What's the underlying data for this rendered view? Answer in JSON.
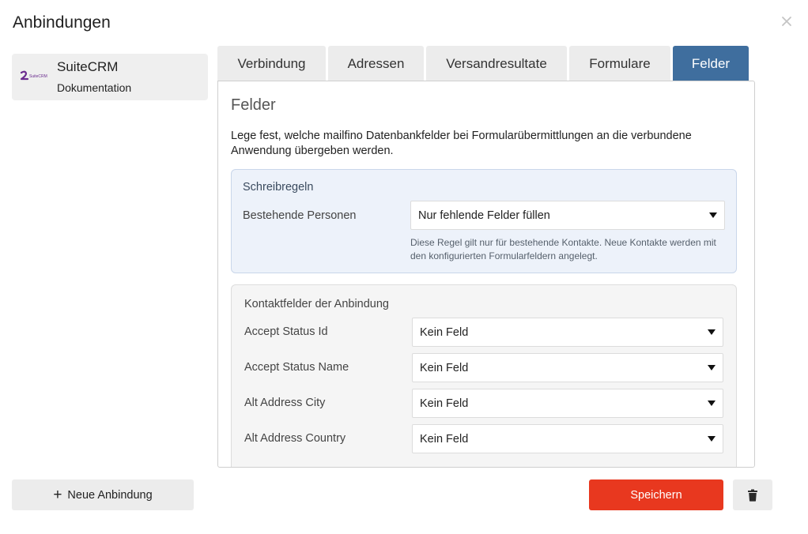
{
  "dialog": {
    "title": "Anbindungen"
  },
  "sidebar": {
    "connection": {
      "name": "SuiteCRM",
      "link": "Dokumentation",
      "logo_text": "SuiteCRM"
    },
    "new_button": "Neue Anbindung"
  },
  "tabs": [
    {
      "label": "Verbindung",
      "active": false
    },
    {
      "label": "Adressen",
      "active": false
    },
    {
      "label": "Versandresultate",
      "active": false
    },
    {
      "label": "Formulare",
      "active": false
    },
    {
      "label": "Felder",
      "active": true
    }
  ],
  "panel": {
    "title": "Felder",
    "description": "Lege fest, welche mailfino Datenbankfelder bei Formularübermittlungen an die verbundene Anwendung übergeben werden.",
    "rules": {
      "title": "Schreibregeln",
      "label": "Bestehende Personen",
      "selected": "Nur fehlende Felder füllen",
      "hint": "Diese Regel gilt nur für bestehende Kontakte. Neue Kontakte werden mit den konfigurierten Formularfeldern angelegt."
    },
    "contact_fields": {
      "title": "Kontaktfelder der Anbindung",
      "rows": [
        {
          "label": "Accept Status Id",
          "value": "Kein Feld"
        },
        {
          "label": "Accept Status Name",
          "value": "Kein Feld"
        },
        {
          "label": "Alt Address City",
          "value": "Kein Feld"
        },
        {
          "label": "Alt Address Country",
          "value": "Kein Feld"
        }
      ]
    }
  },
  "footer": {
    "save": "Speichern"
  },
  "colors": {
    "active_tab": "#3f6e9e",
    "save_button": "#e8381f",
    "rules_box": "#edf2fa"
  }
}
